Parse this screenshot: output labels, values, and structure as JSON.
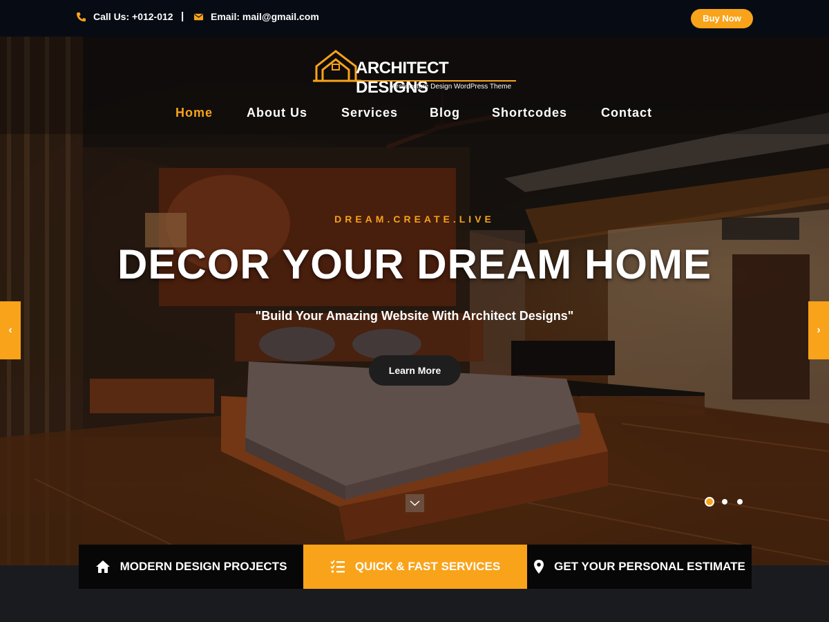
{
  "topbar": {
    "phone": "Call Us: +012-012",
    "separator": "|",
    "email": "Email: mail@gmail.com",
    "buy_now": "Buy Now"
  },
  "logo": {
    "title": "ARCHITECT DESIGNS",
    "subtitle": "Architecture Design WordPress Theme"
  },
  "nav": {
    "items": [
      {
        "label": "Home",
        "active": true
      },
      {
        "label": "About Us",
        "active": false
      },
      {
        "label": "Services",
        "active": false
      },
      {
        "label": "Blog",
        "active": false
      },
      {
        "label": "Shortcodes",
        "active": false
      },
      {
        "label": "Contact",
        "active": false
      }
    ]
  },
  "slider": {
    "kicker": "DREAM.CREATE.LIVE",
    "headline": "DECOR YOUR DREAM HOME",
    "subline": "\"Build Your Amazing Website With Architect Designs\"",
    "button": "Learn More",
    "prev_icon": "‹",
    "next_icon": "›",
    "slide_count": 3,
    "active_slide": 1
  },
  "features": [
    {
      "label": "MODERN DESIGN PROJECTS",
      "icon": "home-icon"
    },
    {
      "label": "QUICK & FAST SERVICES",
      "icon": "list-check-icon"
    },
    {
      "label": "GET YOUR PERSONAL ESTIMATE",
      "icon": "map-pin-icon"
    }
  ],
  "colors": {
    "accent": "#f9a31a",
    "topbar_bg": "#070b14",
    "dark_box": "#070707"
  }
}
